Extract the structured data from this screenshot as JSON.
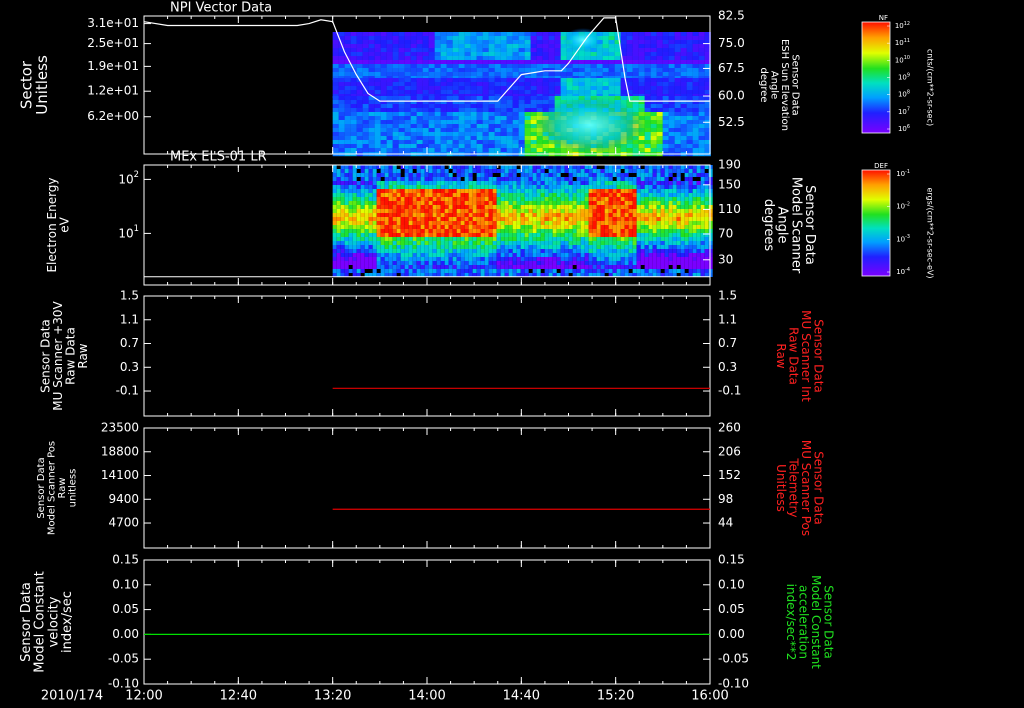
{
  "colors": {
    "background": "#000000",
    "axes": "#ffffff",
    "red_trace": "#e00000",
    "green_trace": "#00e000"
  },
  "time_axis": {
    "date": "2010/174",
    "tick_labels": [
      "12:00",
      "12:40",
      "13:20",
      "14:00",
      "14:40",
      "15:20",
      "16:00"
    ],
    "range_hours": [
      12.0,
      16.0
    ]
  },
  "chart_data": [
    {
      "type": "heatmap",
      "title": "NPI Vector Data",
      "ylabel": [
        "Sector",
        "Unitless"
      ],
      "ytick_labels": [
        "3.1e+01",
        "2.5e+01",
        "1.9e+01",
        "1.2e+01",
        "6.2e+00"
      ],
      "y2label": [
        "Sensor Data",
        "ESH Sun Elevation",
        "Angle",
        "degree"
      ],
      "y2tick_labels": [
        "82.5",
        "75.0",
        "67.5",
        "60.0",
        "52.5"
      ],
      "y2lim": [
        46,
        82.5
      ],
      "data_start_time": "13:20",
      "colorbar": {
        "label": "NF",
        "unit": "cnts/(cm**2-sr-sec)",
        "tick_labels": [
          "10^12",
          "10^11",
          "10^10",
          "10^9",
          "10^8",
          "10^7",
          "10^6"
        ]
      },
      "overlay_line": {
        "name": "ESH Sun Elevation Angle",
        "x": [
          "12:00",
          "12:10",
          "12:30",
          "12:50",
          "13:05",
          "13:10",
          "13:15",
          "13:20",
          "13:25",
          "13:30",
          "13:35",
          "13:40",
          "14:00",
          "14:20",
          "14:30",
          "14:40",
          "14:50",
          "14:57",
          "15:00",
          "15:08",
          "15:15",
          "15:18",
          "15:20",
          "15:22",
          "15:24",
          "15:26",
          "16:00"
        ],
        "y": [
          81.0,
          80.0,
          80.0,
          80.0,
          80.0,
          80.5,
          81.5,
          81.0,
          73.0,
          67.0,
          62.0,
          60.0,
          60.0,
          60.0,
          60.0,
          67.0,
          68.0,
          68.0,
          70.0,
          77.0,
          82.0,
          82.0,
          82.0,
          74.0,
          66.0,
          60.0,
          60.0
        ]
      }
    },
    {
      "type": "heatmap",
      "title": "MEx ELS-01 LR",
      "ylabel": [
        "Electron Energy",
        "eV"
      ],
      "ytick_labels": [
        "10^2",
        "10^1"
      ],
      "y2label": [
        "Sensor Data",
        "Model Scanner",
        "Angle",
        "degrees"
      ],
      "y2tick_labels": [
        "190",
        "150",
        "110",
        "70",
        "30"
      ],
      "y2lim": [
        0,
        190
      ],
      "data_start_time": "13:20",
      "colorbar": {
        "label": "DEF",
        "unit": "ergs/(cm**2-sr-sec-eV)",
        "tick_labels": [
          "10^-1",
          "10^-2",
          "10^-3",
          "10^-4"
        ]
      },
      "overlay_line": {
        "name": "Model Scanner Angle",
        "x": [
          "12:00",
          "16:00"
        ],
        "y": [
          13,
          13
        ]
      }
    },
    {
      "type": "line",
      "ylabel": [
        "Sensor Data",
        "MU Scanner +30V",
        "Raw Data",
        "Raw"
      ],
      "ytick_labels": [
        "1.5",
        "1.1",
        "0.7",
        "0.3",
        "-0.1"
      ],
      "ylim": [
        -0.45,
        1.5
      ],
      "y2label": [
        "Sensor Data",
        "MU Scanner Int",
        "Raw Data",
        "Raw"
      ],
      "y2tick_labels": [
        "1.5",
        "1.1",
        "0.7",
        "0.3",
        "-0.1"
      ],
      "series": [
        {
          "name": "MU Scanner Int Raw Data",
          "x": [
            "13:20",
            "16:00"
          ],
          "y": [
            0.0,
            0.0
          ]
        }
      ]
    },
    {
      "type": "line",
      "ylabel": [
        "Sensor Data",
        "Model Scanner Pos",
        "Raw",
        "unitless"
      ],
      "ytick_labels": [
        "23500",
        "18800",
        "14100",
        "9400",
        "4700"
      ],
      "y2label": [
        "Sensor Data",
        "MU Scanner Pos",
        "Telemetry",
        "Unitless"
      ],
      "y2tick_labels": [
        "260",
        "206",
        "152",
        "98",
        "44"
      ],
      "y2lim": [
        0,
        260
      ],
      "series": [
        {
          "name": "MU Scanner Pos Telemetry",
          "x": [
            "13:20",
            "16:00"
          ],
          "y": [
            84,
            84
          ]
        }
      ]
    },
    {
      "type": "line",
      "ylabel": [
        "Sensor Data",
        "Model Constant",
        "velocity",
        "index/sec"
      ],
      "ytick_labels": [
        "0.15",
        "0.10",
        "0.05",
        "0.00",
        "-0.05",
        "-0.10"
      ],
      "ylim": [
        -0.1,
        0.15
      ],
      "y2label": [
        "Sensor Data",
        "Model Constant",
        "acceleration",
        "index/sec**2"
      ],
      "y2tick_labels": [
        "0.15",
        "0.10",
        "0.05",
        "0.00",
        "-0.05",
        "-0.10"
      ],
      "series": [
        {
          "name": "Model Constant velocity",
          "x": [
            "12:00",
            "16:00"
          ],
          "y": [
            0.0,
            0.0
          ]
        }
      ]
    }
  ]
}
